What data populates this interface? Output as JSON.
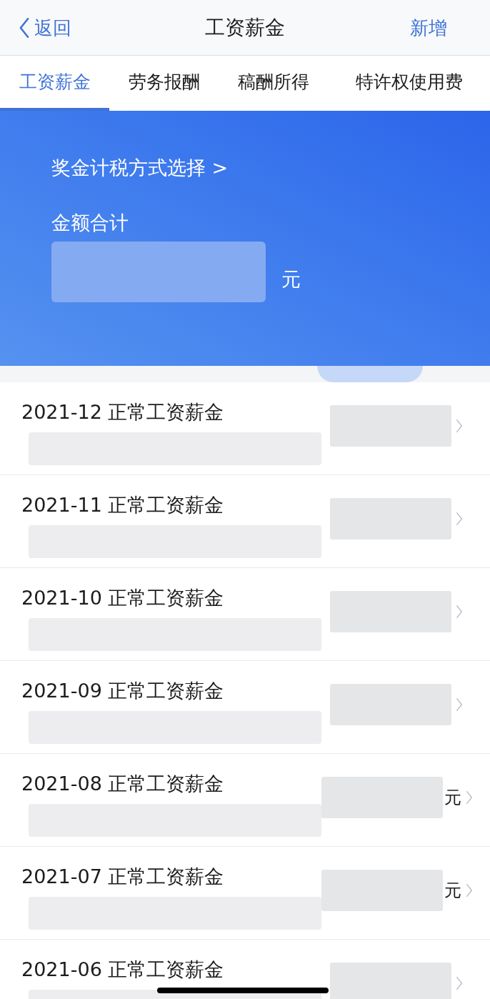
{
  "nav": {
    "back": "返回",
    "title": "工资薪金",
    "action": "新增"
  },
  "tabs": [
    {
      "label": "工资薪金",
      "selected": true
    },
    {
      "label": "劳务报酬",
      "selected": false
    },
    {
      "label": "稿酬所得",
      "selected": false
    },
    {
      "label": "特许权使用费",
      "selected": false
    }
  ],
  "summary": {
    "link": "奖金计税方式选择 >",
    "label": "金额合计",
    "unit": "元"
  },
  "records": [
    {
      "title": "2021-12 正常工资薪金"
    },
    {
      "title": "2021-11 正常工资薪金"
    },
    {
      "title": "2021-10 正常工资薪金"
    },
    {
      "title": "2021-09 正常工资薪金"
    },
    {
      "title": "2021-08 正常工资薪金",
      "unit": "元"
    },
    {
      "title": "2021-07 正常工资薪金",
      "unit": "元"
    },
    {
      "title": "2021-06 正常工资薪金"
    }
  ]
}
